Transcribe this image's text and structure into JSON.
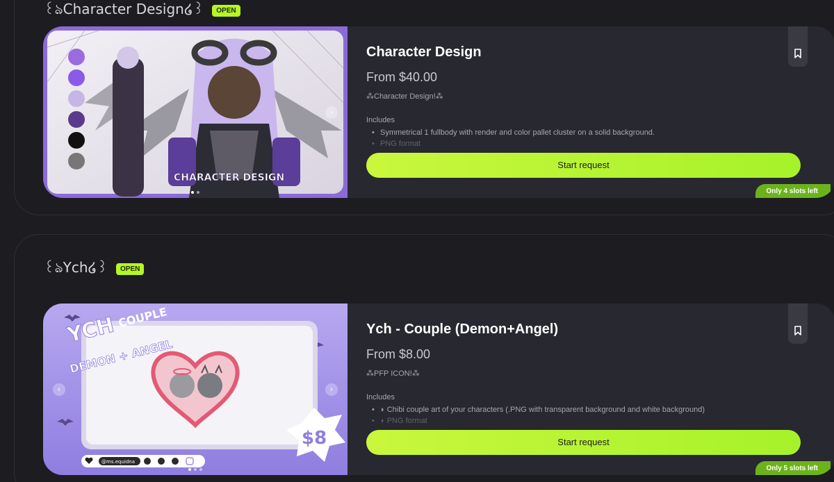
{
  "sections": [
    {
      "title": "꒰ঌCharacter Design໒꒱",
      "badge": "OPEN",
      "card": {
        "title": "Character Design",
        "price": "From $40.00",
        "tagline": "⁂Character Design!⁂",
        "includes_label": "Includes",
        "includes": [
          "Symmetrical 1 fullbody with render and color pallet cluster on a solid background.",
          "PNG format"
        ],
        "button_label": "Start request",
        "slots_label": "Only 4 slots left",
        "image_text": "CHARACTER DESIGN",
        "palette": [
          "#9b6be0",
          "#8a5be8",
          "#c5b6e6",
          "#5a3a8a",
          "#111111",
          "#777777"
        ]
      }
    },
    {
      "title": "꒰ঌYch໒꒱",
      "badge": "OPEN",
      "card": {
        "title": "Ych - Couple (Demon+Angel)",
        "price": "From $8.00",
        "tagline": "⁂PFP ICON!⁂",
        "includes_label": "Includes",
        "includes": [
          "◗ Chibi couple art of your characters (.PNG with transparent background and white background)",
          "◗ PNG format"
        ],
        "button_label": "Start request",
        "slots_label": "Only 5 slots left",
        "image_text": {
          "ych": "YCH",
          "couple": "COUPLE",
          "subtitle": "DEMON + ANGEL",
          "price": "$8",
          "handle": "@ms.equidna"
        }
      }
    }
  ],
  "colors": {
    "accent": "#b6f525",
    "background": "#1c1c21",
    "card": "#282830",
    "slots_badge": "#6cb31b"
  }
}
